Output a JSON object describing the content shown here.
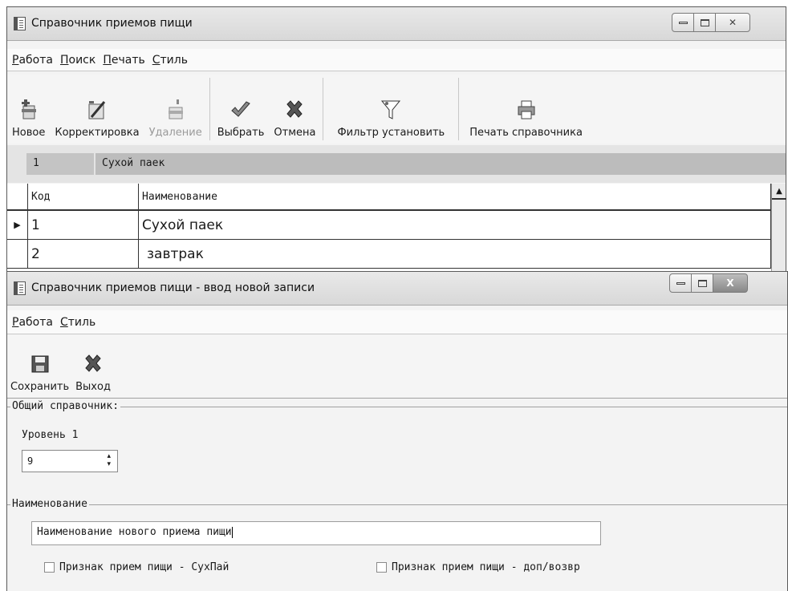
{
  "main_window": {
    "title": "Справочник приемов пищи",
    "menu": [
      "Работа",
      "Поиск",
      "Печать",
      "Стиль"
    ],
    "toolbar": {
      "new": "Новое",
      "edit": "Корректировка",
      "delete": "Удаление",
      "select": "Выбрать",
      "cancel": "Отмена",
      "filter": "Фильтр установить",
      "print": "Печать справочника"
    },
    "selected": {
      "code": "1",
      "name": "Сухой паек"
    },
    "grid": {
      "columns": [
        "Код",
        "Наименование"
      ],
      "rows": [
        {
          "code": "1",
          "name": "Сухой паек"
        },
        {
          "code": "2",
          "name": "завтрак"
        }
      ]
    }
  },
  "dialog": {
    "title": "Справочник приемов пищи - ввод новой записи",
    "menu": [
      "Работа",
      "Стиль"
    ],
    "toolbar": {
      "save": "Сохранить",
      "exit": "Выход"
    },
    "general_group": {
      "label": "Общий справочник:",
      "level_label": "Уровень 1",
      "level_value": "9"
    },
    "name_group": {
      "label": "Наименование",
      "value": "Наименование нового приема пищи"
    },
    "checkboxes": [
      {
        "label": "Признак прием пищи - СухПай",
        "checked": false
      },
      {
        "label": "Признак прием пищи - доп/возвр",
        "checked": false
      }
    ]
  },
  "colors": {
    "check_green": "#6a6a6a",
    "cross": "#5a5a5a"
  }
}
